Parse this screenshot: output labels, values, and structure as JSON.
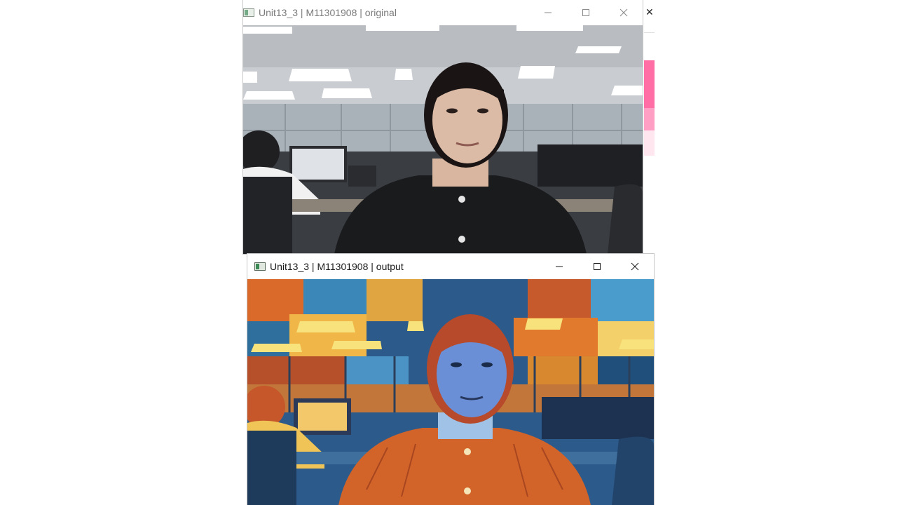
{
  "windows": {
    "original": {
      "title": "Unit13_3 | M11301908 | original",
      "controls": {
        "minimize": "minimize",
        "maximize": "maximize",
        "close": "close"
      }
    },
    "output": {
      "title": "Unit13_3 | M11301908 | output",
      "controls": {
        "minimize": "minimize",
        "maximize": "maximize",
        "close": "close"
      }
    }
  },
  "background_window": {
    "close_glyph": "✕"
  },
  "icons": {
    "app": "opencv-window-icon",
    "minimize": "minimize-icon",
    "maximize": "maximize-icon",
    "close": "close-icon"
  },
  "colors": {
    "titlebar_bg": "#ffffff",
    "inactive_title": "#7a7a7a",
    "active_title": "#1a1a1a",
    "accent_pink": "#ff6fa6"
  }
}
